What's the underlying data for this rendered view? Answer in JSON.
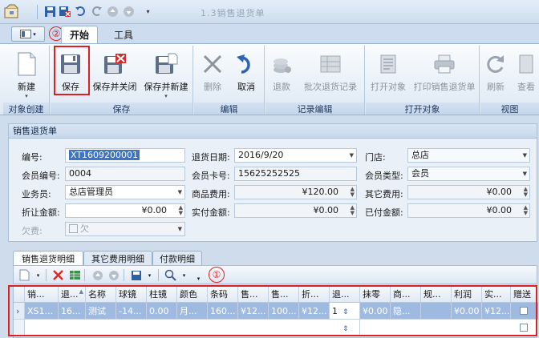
{
  "window": {
    "title": "1.3销售退货单"
  },
  "quick_access": {
    "icons": [
      "save-icon",
      "save-close-icon",
      "undo-icon",
      "redo-icon",
      "back-icon",
      "forward-icon",
      "customize-icon"
    ]
  },
  "tabs": {
    "start": "开始",
    "tools": "工具"
  },
  "annotations": {
    "one": "①",
    "two": "②"
  },
  "ribbon": {
    "groups": [
      {
        "label": "对象创建",
        "buttons": [
          {
            "label": "新建"
          }
        ]
      },
      {
        "label": "保存",
        "buttons": [
          {
            "label": "保存"
          },
          {
            "label": "保存并关闭"
          },
          {
            "label": "保存并新建"
          }
        ]
      },
      {
        "label": "编辑",
        "buttons": [
          {
            "label": "删除"
          },
          {
            "label": "取消"
          }
        ]
      },
      {
        "label": "记录编辑",
        "buttons": [
          {
            "label": "退款"
          },
          {
            "label": "批次退货记录"
          }
        ]
      },
      {
        "label": "打开对象",
        "buttons": [
          {
            "label": "打开对象"
          },
          {
            "label": "打印销售退货单"
          }
        ]
      },
      {
        "label": "视图",
        "buttons": [
          {
            "label": "刷新"
          },
          {
            "label": "查看"
          }
        ]
      }
    ]
  },
  "form": {
    "title": "销售退货单",
    "labels": {
      "code": "编号:",
      "return_date": "退货日期:",
      "store": "门店:",
      "member_no": "会员编号:",
      "member_card": "会员卡号:",
      "member_type": "会员类型:",
      "salesperson": "业务员:",
      "goods_cost": "商品费用:",
      "other_cost": "其它费用:",
      "discount": "折让金额:",
      "actual_pay": "实付金额:",
      "paid": "已付金额:",
      "owed": "欠费:"
    },
    "values": {
      "code": "XT1609200001",
      "return_date": "2016/9/20",
      "store": "总店",
      "member_no": "0004",
      "member_card": "15625252525",
      "member_type": "会员",
      "salesperson": "总店管理员",
      "goods_cost": "¥120.00",
      "other_cost": "¥0.00",
      "discount": "¥0.00",
      "actual_pay": "¥0.00",
      "paid": "¥0.00",
      "owed": "欠"
    }
  },
  "detail_tabs": [
    "销售退货明细",
    "其它费用明细",
    "付款明细"
  ],
  "grid": {
    "headers": [
      "销...",
      "退...",
      "名称",
      "球镜",
      "柱镜",
      "颜色",
      "条码",
      "售...",
      "售...",
      "折...",
      "退...",
      "抹零",
      "商...",
      "规...",
      "利润",
      "实...",
      "赠送"
    ],
    "row": [
      "XS1...",
      "16...",
      "测试",
      "-14...",
      "0.00",
      "月...",
      "160...",
      "¥12...",
      "100...",
      "¥12...",
      "1",
      "¥0.00",
      "隐...",
      "",
      "¥0.00",
      "¥12...",
      ""
    ]
  }
}
